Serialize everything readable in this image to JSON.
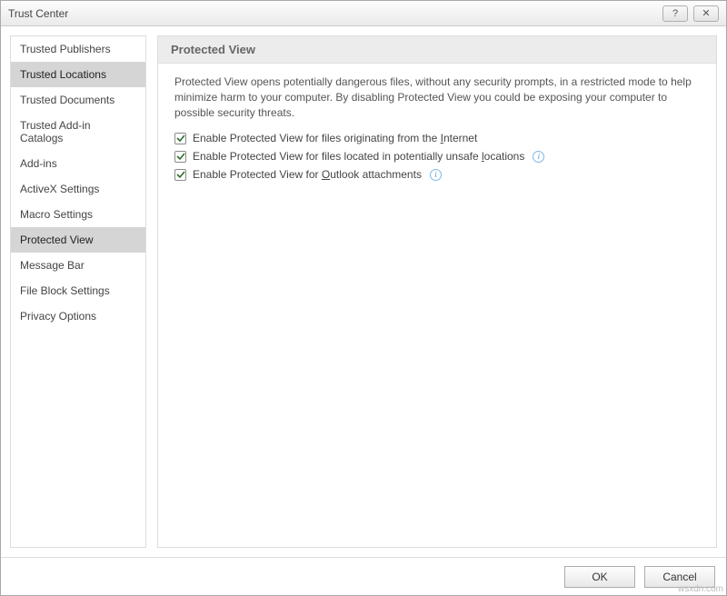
{
  "window": {
    "title": "Trust Center",
    "help_glyph": "?",
    "close_glyph": "✕"
  },
  "sidebar": {
    "items": [
      {
        "label": "Trusted Publishers"
      },
      {
        "label": "Trusted Locations"
      },
      {
        "label": "Trusted Documents"
      },
      {
        "label": "Trusted Add-in Catalogs"
      },
      {
        "label": "Add-ins"
      },
      {
        "label": "ActiveX Settings"
      },
      {
        "label": "Macro Settings"
      },
      {
        "label": "Protected View"
      },
      {
        "label": "Message Bar"
      },
      {
        "label": "File Block Settings"
      },
      {
        "label": "Privacy Options"
      }
    ],
    "selected_index": 7,
    "highlighted_index": 1
  },
  "content": {
    "section_title": "Protected View",
    "description": "Protected View opens potentially dangerous files, without any security prompts, in a restricted mode to help minimize harm to your computer. By disabling Protected View you could be exposing your computer to possible security threats.",
    "options": [
      {
        "checked": true,
        "label_pre": "Enable Protected View for files originating from the ",
        "accel": "I",
        "label_post": "nternet",
        "info": false
      },
      {
        "checked": true,
        "label_pre": "Enable Protected View for files located in potentially unsafe ",
        "accel": "l",
        "label_post": "ocations",
        "info": true
      },
      {
        "checked": true,
        "label_pre": "Enable Protected View for ",
        "accel": "O",
        "label_post": "utlook attachments",
        "info": true
      }
    ]
  },
  "footer": {
    "ok": "OK",
    "cancel": "Cancel"
  },
  "watermark": "wsxdn.com"
}
